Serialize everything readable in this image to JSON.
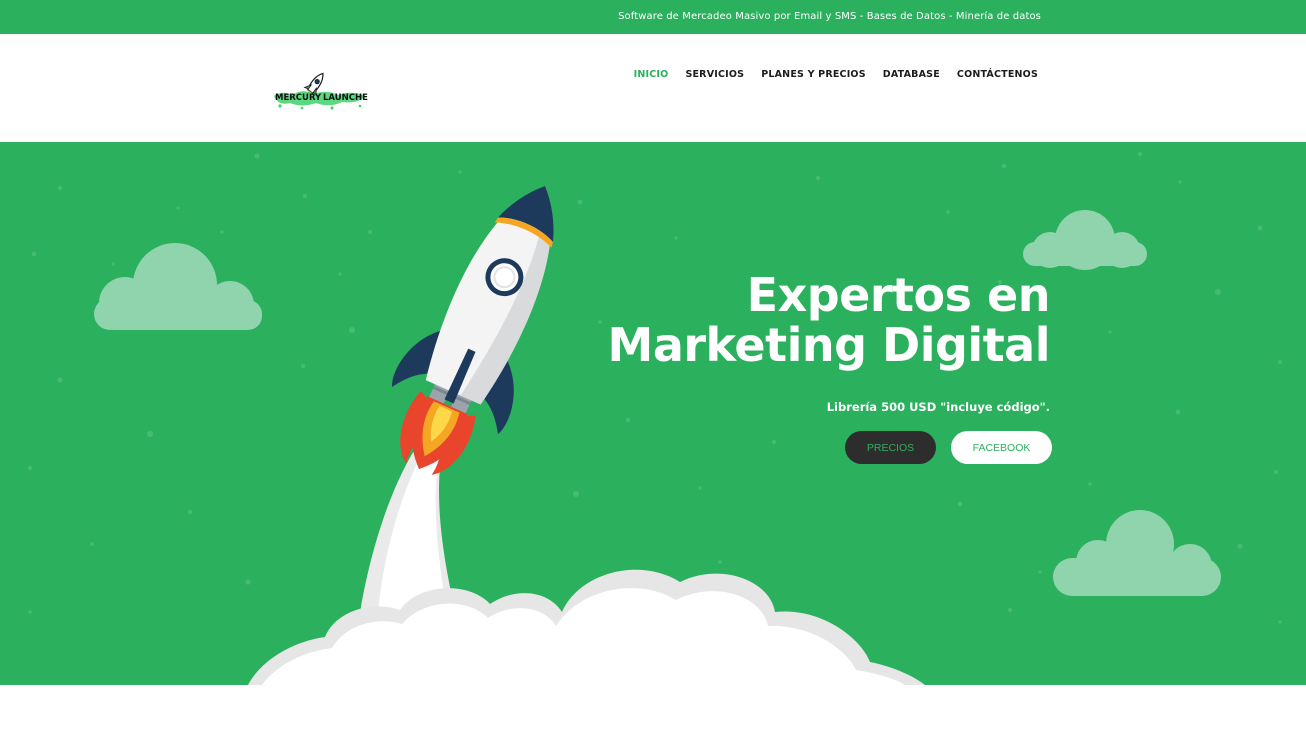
{
  "topbar": {
    "tagline": "Software de Mercadeo Masivo por Email y SMS - Bases de Datos - Minería de datos"
  },
  "header": {
    "logo_text_left": "MERCURY",
    "logo_text_right": "LAUNCHER",
    "nav": [
      {
        "label": "INICIO",
        "active": true
      },
      {
        "label": "SERVICIOS",
        "active": false
      },
      {
        "label": "PLANES Y PRECIOS",
        "active": false
      },
      {
        "label": "DATABASE",
        "active": false
      },
      {
        "label": "CONTÁCTENOS",
        "active": false
      }
    ]
  },
  "hero": {
    "title_line1": "Expertos en",
    "title_line2": "Marketing Digital",
    "subtitle": "Librería 500 USD \"incluye código\".",
    "primary_button": "PRECIOS",
    "secondary_button": "FACEBOOK"
  },
  "colors": {
    "brand_green": "#2bb05e",
    "dark_button": "#2d2d2d",
    "cloud": "#8fd4ac",
    "rocket_navy": "#1d3a5c",
    "flame_orange": "#f5a623",
    "flame_red": "#e8452c"
  },
  "icons": {
    "logo": "rocket-logo-icon",
    "hero_illustration": "rocket-illustration"
  }
}
